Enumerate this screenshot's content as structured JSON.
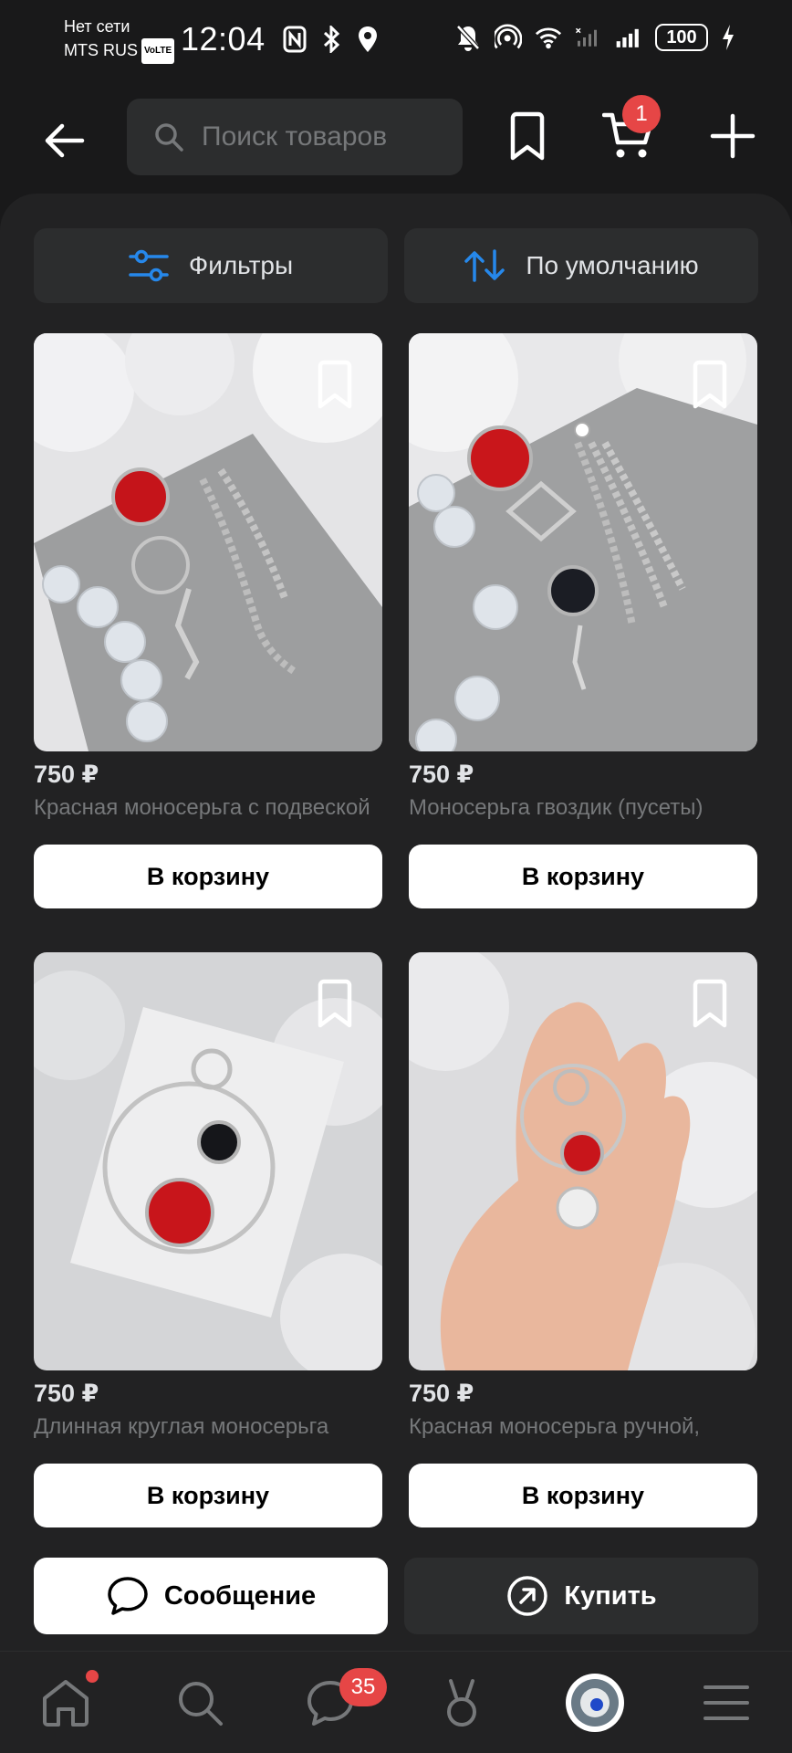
{
  "status_bar": {
    "carrier_line1": "Нет сети",
    "carrier_line2": "MTS RUS",
    "volte": "VoLTE",
    "time": "12:04",
    "battery": "100"
  },
  "header": {
    "search_placeholder": "Поиск товаров",
    "cart_count": "1"
  },
  "toolbar": {
    "filters_label": "Фильтры",
    "sort_label": "По умолчанию"
  },
  "products": [
    {
      "price": "750 ₽",
      "title": "Красная моносерьга с подвеской",
      "button": "В корзину"
    },
    {
      "price": "750 ₽",
      "title": "Моносерьга гвоздик (пусеты)",
      "button": "В корзину"
    },
    {
      "price": "750 ₽",
      "title": "Длинная круглая моносерьга",
      "button": "В корзину"
    },
    {
      "price": "750 ₽",
      "title": "Красная моносерьга ручной,",
      "button": "В корзину"
    }
  ],
  "actions": {
    "message_label": "Сообщение",
    "buy_label": "Купить"
  },
  "tab_bar": {
    "messages_badge": "35"
  },
  "colors": {
    "accent": "#2688eb",
    "badge": "#e64646",
    "background": "#19191a",
    "surface": "#2c2d2e"
  }
}
